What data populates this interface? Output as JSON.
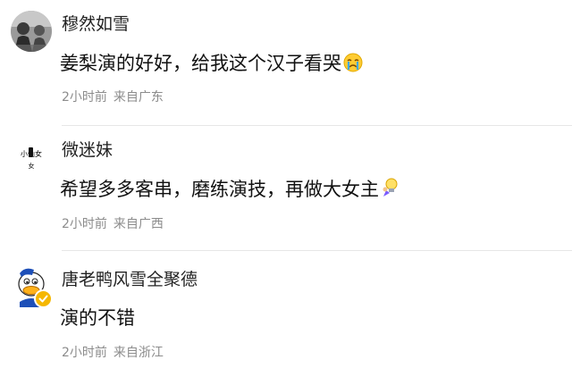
{
  "comments": [
    {
      "username": "穆然如雪",
      "text": "姜梨演的好好，给我这个汉子看哭",
      "emoji": "crying-face-emoji",
      "time": "2小时前",
      "location_prefix": "来自",
      "location": "广东"
    },
    {
      "username": "微迷妹",
      "text": "希望多多客串，磨练演技，再做大女主",
      "emoji": "lightbulb-emoji",
      "time": "2小时前",
      "location_prefix": "来自",
      "location": "广西"
    },
    {
      "username": "唐老鸭风雪全聚德",
      "text": "演的不错",
      "verified_badge": "verified-badge-icon",
      "time": "2小时前",
      "location_prefix": "来自",
      "location": "浙江"
    }
  ],
  "colors": {
    "username": "#222222",
    "text": "#111111",
    "meta": "#8c8c8c",
    "divider": "#e6e6e6",
    "badge": "#f5b700"
  }
}
